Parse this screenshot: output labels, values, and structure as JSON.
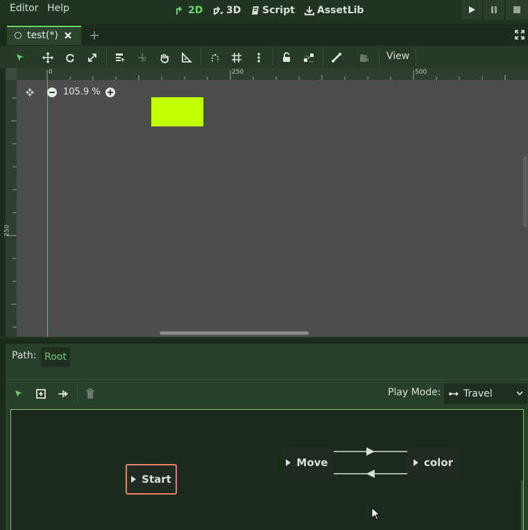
{
  "menu": {
    "editor": "Editor",
    "help": "Help"
  },
  "workspaces": [
    {
      "label": "2D",
      "icon": "2d-icon",
      "active": true
    },
    {
      "label": "3D",
      "icon": "3d-icon",
      "active": false
    },
    {
      "label": "Script",
      "icon": "script-icon",
      "active": false
    },
    {
      "label": "AssetLib",
      "icon": "assetlib-icon",
      "active": false
    }
  ],
  "tab": {
    "label": "test(*)"
  },
  "toolbar": {
    "view_label": "View"
  },
  "viewport": {
    "zoom_label": "105.9 %",
    "ruler_top_labels": [
      "0",
      "250",
      "500"
    ],
    "ruler_left_label": "250",
    "rect_color": "#bfff00"
  },
  "animation_tree": {
    "path_label": "Path:",
    "path_value": "Root",
    "play_mode_label": "Play Mode:",
    "play_mode_value": "Travel",
    "nodes": {
      "start": "Start",
      "move": "Move",
      "color": "color"
    }
  },
  "colors": {
    "accent": "#69d86b",
    "start_border": "#f0806a"
  }
}
